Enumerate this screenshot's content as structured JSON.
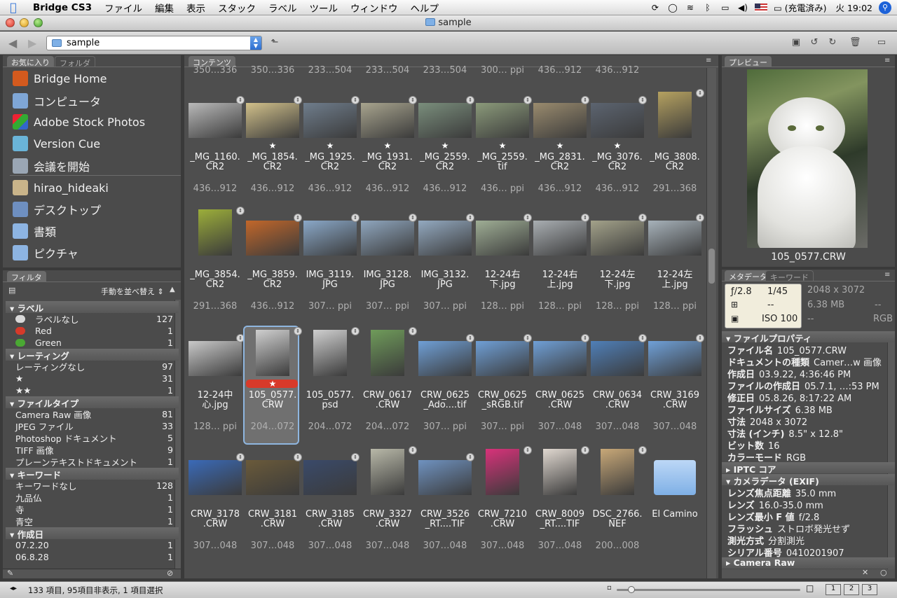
{
  "menubar": {
    "app": "Bridge CS3",
    "items": [
      "ファイル",
      "編集",
      "表示",
      "スタック",
      "ラベル",
      "ツール",
      "ウィンドウ",
      "ヘルプ"
    ],
    "battery": "(充電済み)",
    "clock": "火 19:02"
  },
  "window": {
    "title": "sample"
  },
  "toolbar": {
    "path": "sample"
  },
  "favorites": {
    "tabs": [
      "お気に入り",
      "フォルダ"
    ],
    "items": [
      "Bridge Home",
      "コンピュータ",
      "Adobe Stock Photos",
      "Version Cue",
      "会議を開始",
      "hirao_hideaki",
      "デスクトップ",
      "書類",
      "ピクチャ"
    ]
  },
  "filter": {
    "tab": "フィルタ",
    "sort": "手動を並べ替え",
    "sections": [
      {
        "title": "ラベル",
        "rows": [
          [
            "ラベルなし",
            "127"
          ],
          [
            "Red",
            "1"
          ],
          [
            "Green",
            "1"
          ]
        ]
      },
      {
        "title": "レーティング",
        "rows": [
          [
            "レーティングなし",
            "97"
          ],
          [
            "★",
            "31"
          ],
          [
            "★★",
            "1"
          ]
        ]
      },
      {
        "title": "ファイルタイプ",
        "rows": [
          [
            "Camera Raw 画像",
            "81"
          ],
          [
            "JPEG ファイル",
            "33"
          ],
          [
            "Photoshop ドキュメント",
            "5"
          ],
          [
            "TIFF 画像",
            "9"
          ],
          [
            "プレーンテキストドキュメント",
            "1"
          ]
        ]
      },
      {
        "title": "キーワード",
        "rows": [
          [
            "キーワードなし",
            "128"
          ],
          [
            "九品仏",
            "1"
          ],
          [
            "寺",
            "1"
          ],
          [
            "青空",
            "1"
          ]
        ]
      },
      {
        "title": "作成日",
        "rows": [
          [
            "07.2.20",
            "1"
          ],
          [
            "06.8.28",
            "1"
          ]
        ]
      }
    ]
  },
  "content": {
    "tab": "コンテンツ",
    "toprow": [
      "350…336",
      "350…336",
      "233…504",
      "233…504",
      "233…504",
      "300… ppi",
      "436…912",
      "436…912"
    ],
    "rows": [
      [
        {
          "n": "_MG_1160.\nCR2",
          "d": "436…912",
          "s": ""
        },
        {
          "n": "_MG_1854.\nCR2",
          "d": "436…912",
          "s": "★"
        },
        {
          "n": "_MG_1925.\nCR2",
          "d": "436…912",
          "s": "★"
        },
        {
          "n": "_MG_1931.\nCR2",
          "d": "436…912",
          "s": "★"
        },
        {
          "n": "_MG_2559.\nCR2",
          "d": "436…912",
          "s": "★"
        },
        {
          "n": "_MG_2559.\ntif",
          "d": "436… ppi",
          "s": "★"
        },
        {
          "n": "_MG_2831.\nCR2",
          "d": "436…912",
          "s": "★"
        },
        {
          "n": "_MG_3076.\nCR2",
          "d": "436…912",
          "s": "★"
        },
        {
          "n": "_MG_3808.\nCR2",
          "d": "291…368",
          "s": ""
        }
      ],
      [
        {
          "n": "_MG_3854.\nCR2",
          "d": "291…368",
          "s": ""
        },
        {
          "n": "_MG_3859.\nCR2",
          "d": "436…912",
          "s": ""
        },
        {
          "n": "IMG_3119.\nJPG",
          "d": "307… ppi",
          "s": ""
        },
        {
          "n": "IMG_3128.\nJPG",
          "d": "307… ppi",
          "s": ""
        },
        {
          "n": "IMG_3132.\nJPG",
          "d": "307… ppi",
          "s": ""
        },
        {
          "n": "12-24右\n下.jpg",
          "d": "128… ppi",
          "s": ""
        },
        {
          "n": "12-24右\n上.jpg",
          "d": "128… ppi",
          "s": ""
        },
        {
          "n": "12-24左\n下.jpg",
          "d": "128… ppi",
          "s": ""
        },
        {
          "n": "12-24左\n上.jpg",
          "d": "128… ppi",
          "s": ""
        }
      ],
      [
        {
          "n": "12-24中\n心.jpg",
          "d": "128… ppi",
          "s": ""
        },
        {
          "n": "105_0577.\nCRW",
          "d": "204…072",
          "s": "★"
        },
        {
          "n": "105_0577.\npsd",
          "d": "204…072",
          "s": ""
        },
        {
          "n": "CRW_0617\n.CRW",
          "d": "204…072",
          "s": ""
        },
        {
          "n": "CRW_0625\n_Ado....tif",
          "d": "307… ppi",
          "s": ""
        },
        {
          "n": "CRW_0625\n_sRGB.tif",
          "d": "307… ppi",
          "s": ""
        },
        {
          "n": "CRW_0625\n.CRW",
          "d": "307…048",
          "s": ""
        },
        {
          "n": "CRW_0634\n.CRW",
          "d": "307…048",
          "s": ""
        },
        {
          "n": "CRW_3169\n.CRW",
          "d": "307…048",
          "s": ""
        }
      ],
      [
        {
          "n": "CRW_3178\n.CRW",
          "d": "307…048",
          "s": ""
        },
        {
          "n": "CRW_3181\n.CRW",
          "d": "307…048",
          "s": ""
        },
        {
          "n": "CRW_3185\n.CRW",
          "d": "307…048",
          "s": ""
        },
        {
          "n": "CRW_3327\n.CRW",
          "d": "307…048",
          "s": ""
        },
        {
          "n": "CRW_3526\n_RT....TIF",
          "d": "307…048",
          "s": ""
        },
        {
          "n": "CRW_7210\n.CRW",
          "d": "307…048",
          "s": ""
        },
        {
          "n": "CRW_8009\n_RT....TIF",
          "d": "307…048",
          "s": ""
        },
        {
          "n": "DSC_2766.\nNEF",
          "d": "200…008",
          "s": ""
        },
        {
          "n": "El Camino",
          "d": "",
          "s": ""
        }
      ]
    ]
  },
  "preview": {
    "tab": "プレビュー",
    "caption": "105_0577.CRW"
  },
  "metadata": {
    "tabs": [
      "メタデータ",
      "キーワード"
    ],
    "camera": {
      "fstop": "ƒ/2.8",
      "shutter": "1/45",
      "dash": "--",
      "iso": "ISO 100"
    },
    "doc": {
      "dim": "2048 x 3072",
      "size": "6.38 MB",
      "dash1": "--",
      "dash2": "--",
      "mode": "RGB"
    },
    "sections": [
      {
        "title": "ファイルプロパティ",
        "rows": [
          [
            "ファイル名",
            "105_0577.CRW"
          ],
          [
            "ドキュメントの種類",
            "Camer…w 画像"
          ],
          [
            "作成日",
            "03.9.22, 4:36:46 PM"
          ],
          [
            "ファイルの作成日",
            "05.7.1, …:53 PM"
          ],
          [
            "修正日",
            "05.8.26, 8:17:22 AM"
          ],
          [
            "ファイルサイズ",
            "6.38 MB"
          ],
          [
            "寸法",
            "2048 x 3072"
          ],
          [
            "寸法 (インチ)",
            "8.5\" x 12.8\""
          ],
          [
            "ビット数",
            "16"
          ],
          [
            "カラーモード",
            "RGB"
          ]
        ]
      },
      {
        "title": "IPTC コア",
        "rows": []
      },
      {
        "title": "カメラデータ (EXIF)",
        "rows": [
          [
            "レンズ焦点距離",
            "35.0 mm"
          ],
          [
            "レンズ",
            "16.0-35.0 mm"
          ],
          [
            "レンズ最小 F 値",
            "f/2.8"
          ],
          [
            "フラッシュ",
            "ストロボ発光せず"
          ],
          [
            "測光方式",
            "分割測光"
          ],
          [
            "シリアル番号",
            "0410201907"
          ]
        ]
      },
      {
        "title": "Camera Raw",
        "rows": []
      }
    ]
  },
  "status": {
    "text": "133 項目, 95項目非表示, 1 項目選択",
    "views": [
      "1",
      "2",
      "3"
    ]
  }
}
